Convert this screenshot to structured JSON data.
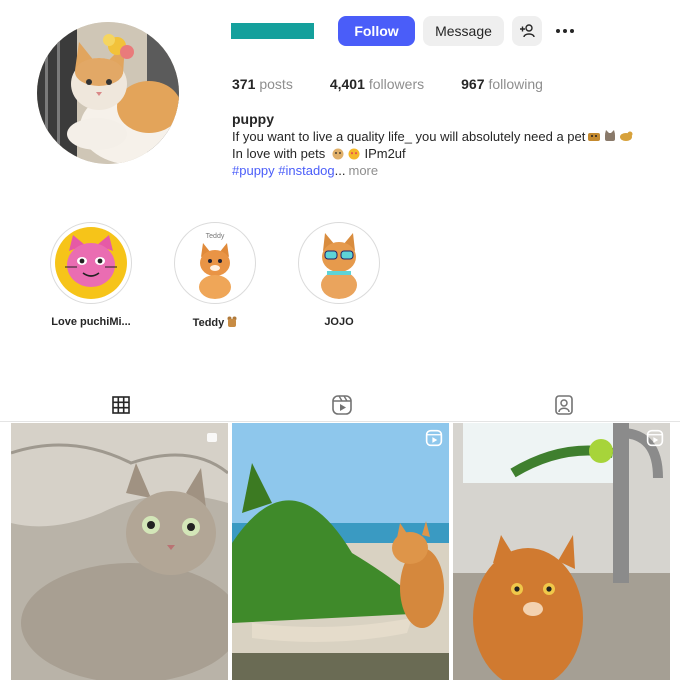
{
  "profile": {
    "actions": {
      "follow": "Follow",
      "message": "Message"
    },
    "stats": {
      "posts": "371",
      "posts_label": "posts",
      "followers": "4,401",
      "followers_label": "followers",
      "following": "967",
      "following_label": "following"
    },
    "bio": {
      "name": "puppy",
      "line1": "If you want to live a quality life_ you will absolutely need a pet",
      "line2_text": "In love with pets",
      "line2_link": "IPm2uf",
      "tags": "#puppy #instadog",
      "ellipsis": "...",
      "more": "more"
    }
  },
  "highlights": [
    {
      "label": "Love puchiMi..."
    },
    {
      "label": "Teddy",
      "inner_text": "Teddy"
    },
    {
      "label": "JOJO"
    }
  ],
  "tabs": [
    {
      "icon": "grid-icon",
      "active": true
    },
    {
      "icon": "reels-icon",
      "active": false
    },
    {
      "icon": "tagged-icon",
      "active": false
    }
  ],
  "colors": {
    "accent": "#4a5df9",
    "username_bar": "#14a09c",
    "muted": "#8e8e8e"
  }
}
